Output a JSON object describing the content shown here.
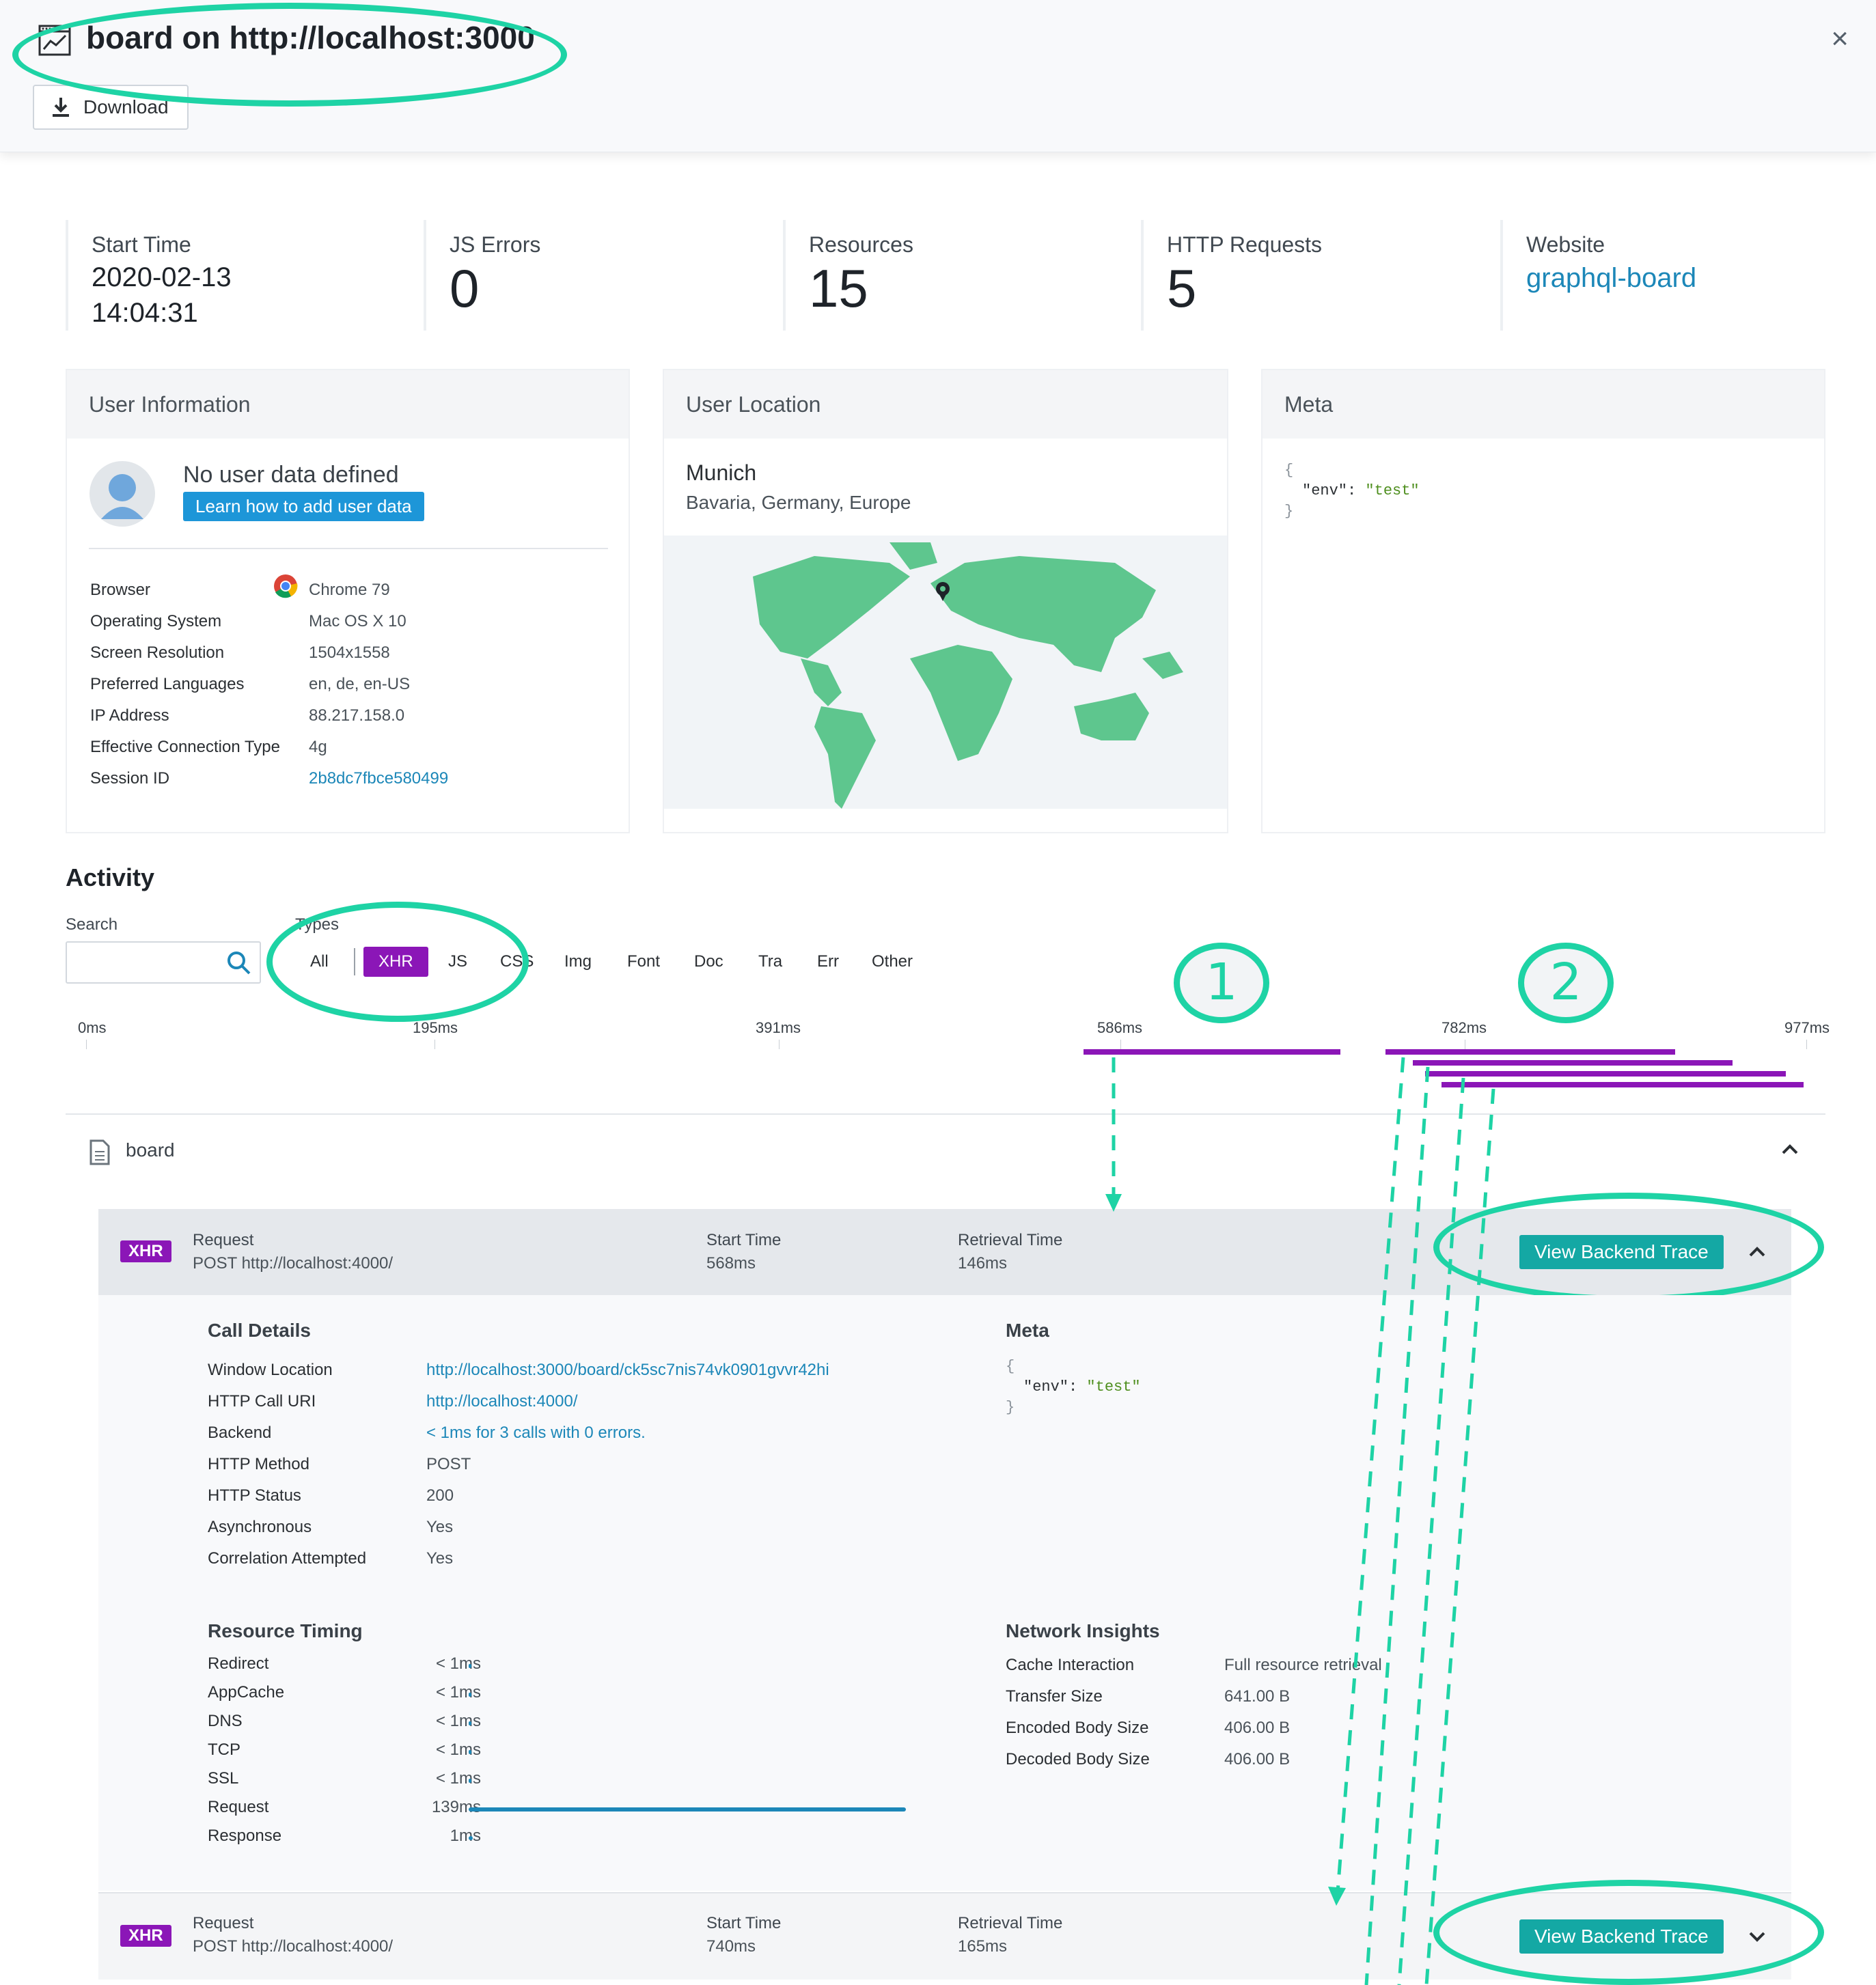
{
  "header": {
    "title": "board on http://localhost:3000",
    "download_label": "Download",
    "close_glyph": "×"
  },
  "stats": {
    "start_time_label": "Start Time",
    "start_date": "2020-02-13",
    "start_clock": "14:04:31",
    "js_errors_label": "JS Errors",
    "js_errors": "0",
    "resources_label": "Resources",
    "resources": "15",
    "http_label": "HTTP Requests",
    "http": "5",
    "website_label": "Website",
    "website": "graphql-board"
  },
  "user_info": {
    "title": "User Information",
    "no_data": "No user data defined",
    "learn_btn": "Learn how to add user data",
    "rows": [
      {
        "label": "Browser",
        "value": "Chrome 79"
      },
      {
        "label": "Operating System",
        "value": "Mac OS X 10"
      },
      {
        "label": "Screen Resolution",
        "value": "1504x1558"
      },
      {
        "label": "Preferred Languages",
        "value": "en, de, en-US"
      },
      {
        "label": "IP Address",
        "value": "88.217.158.0"
      },
      {
        "label": "Effective Connection Type",
        "value": "4g"
      },
      {
        "label": "Session ID",
        "value": "2b8dc7fbce580499"
      }
    ]
  },
  "user_location": {
    "title": "User Location",
    "city": "Munich",
    "region": "Bavaria, Germany, Europe"
  },
  "meta": {
    "title": "Meta",
    "open": "{",
    "line": "\"env\": \"test\"",
    "key": "\"env\"",
    "colon": ": ",
    "value": "\"test\"",
    "close": "}"
  },
  "activity": {
    "title": "Activity",
    "search_label": "Search",
    "search_placeholder": "",
    "types_label": "Types",
    "types": [
      "All",
      "XHR",
      "JS",
      "CSS",
      "Img",
      "Font",
      "Doc",
      "Tra",
      "Err",
      "Other"
    ],
    "active_type": "XHR",
    "ticks": [
      "0ms",
      "195ms",
      "391ms",
      "586ms",
      "782ms",
      "977ms"
    ],
    "annotations": [
      "1",
      "2"
    ],
    "page_group": "board"
  },
  "requests": [
    {
      "badge": "XHR",
      "request_label": "Request",
      "request": "POST http://localhost:4000/",
      "start_label": "Start Time",
      "start": "568ms",
      "retrieval_label": "Retrieval Time",
      "retrieval": "146ms",
      "view_trace": "View Backend Trace"
    },
    {
      "badge": "XHR",
      "request_label": "Request",
      "request": "POST http://localhost:4000/",
      "start_label": "Start Time",
      "start": "740ms",
      "retrieval_label": "Retrieval Time",
      "retrieval": "165ms",
      "view_trace": "View Backend Trace"
    }
  ],
  "call_details": {
    "title": "Call Details",
    "rows": [
      {
        "label": "Window Location",
        "value": "http://localhost:3000/board/ck5sc7nis74vk0901gvvr42hi",
        "link": true
      },
      {
        "label": "HTTP Call URI",
        "value": "http://localhost:4000/",
        "link": true
      },
      {
        "label": "Backend",
        "value": "< 1ms for 3 calls with 0 errors.",
        "link": true
      },
      {
        "label": "HTTP Method",
        "value": "POST",
        "link": false
      },
      {
        "label": "HTTP Status",
        "value": "200",
        "link": false
      },
      {
        "label": "Asynchronous",
        "value": "Yes",
        "link": false
      },
      {
        "label": "Correlation Attempted",
        "value": "Yes",
        "link": false
      }
    ],
    "meta_title": "Meta"
  },
  "resource_timing": {
    "title": "Resource Timing",
    "rows": [
      {
        "label": "Redirect",
        "value": "< 1ms",
        "fraction": 0
      },
      {
        "label": "AppCache",
        "value": "< 1ms",
        "fraction": 0
      },
      {
        "label": "DNS",
        "value": "< 1ms",
        "fraction": 0
      },
      {
        "label": "TCP",
        "value": "< 1ms",
        "fraction": 0
      },
      {
        "label": "SSL",
        "value": "< 1ms",
        "fraction": 0
      },
      {
        "label": "Request",
        "value": "139ms",
        "fraction": 1
      },
      {
        "label": "Response",
        "value": "1ms",
        "fraction": 0.01
      }
    ]
  },
  "network_insights": {
    "title": "Network Insights",
    "rows": [
      {
        "label": "Cache Interaction",
        "value": "Full resource retrieval"
      },
      {
        "label": "Transfer Size",
        "value": "641.00 B"
      },
      {
        "label": "Encoded Body Size",
        "value": "406.00 B"
      },
      {
        "label": "Decoded Body Size",
        "value": "406.00 B"
      }
    ]
  },
  "colors": {
    "accent_purple": "#8b16b7",
    "annotation_green": "#1ed3a5",
    "trace_teal": "#14a8a4",
    "link_blue": "#1c87b8",
    "map_green": "#5ec68e"
  }
}
